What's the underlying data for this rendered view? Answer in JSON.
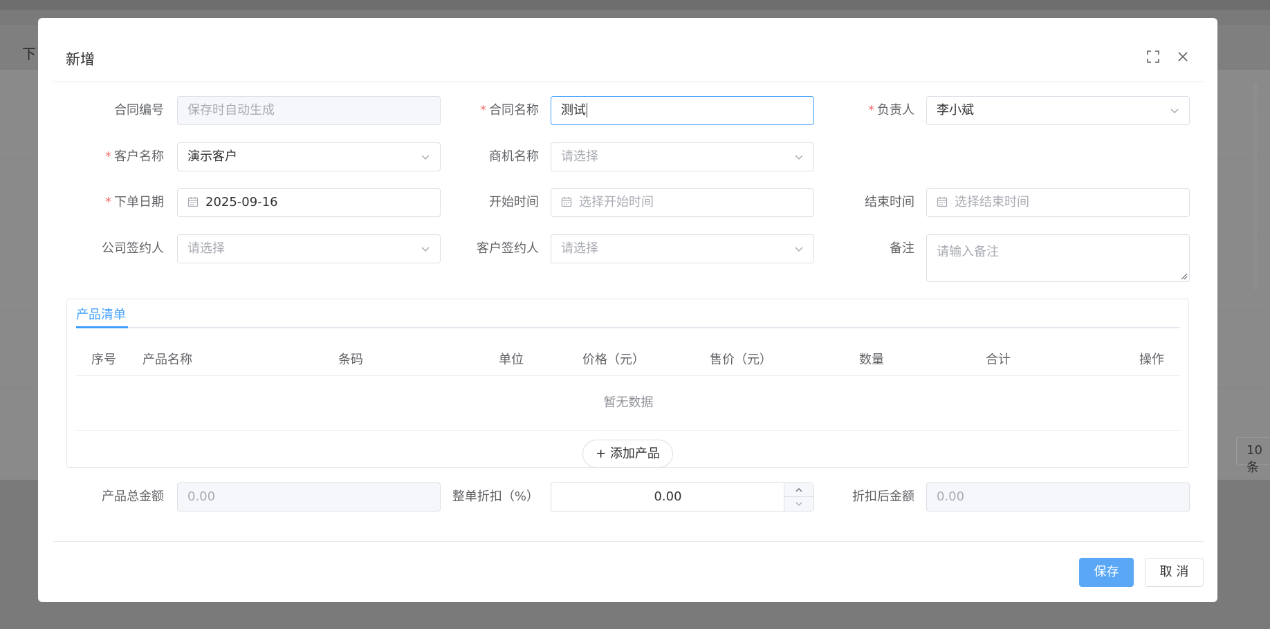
{
  "background": {
    "title": "下",
    "page_size": "10条"
  },
  "dialog": {
    "title": "新增",
    "fields": {
      "contract_no": {
        "label": "合同编号",
        "placeholder": "保存时自动生成"
      },
      "contract_name": {
        "label": "合同名称",
        "value": "测试"
      },
      "owner": {
        "label": "负责人",
        "value": "李小斌"
      },
      "customer": {
        "label": "客户名称",
        "value": "演示客户"
      },
      "opportunity": {
        "label": "商机名称",
        "placeholder": "请选择"
      },
      "order_date": {
        "label": "下单日期",
        "value": "2025-09-16"
      },
      "start_time": {
        "label": "开始时间",
        "placeholder": "选择开始时间"
      },
      "end_time": {
        "label": "结束时间",
        "placeholder": "选择结束时间"
      },
      "company_signer": {
        "label": "公司签约人",
        "placeholder": "请选择"
      },
      "customer_signer": {
        "label": "客户签约人",
        "placeholder": "请选择"
      },
      "remark": {
        "label": "备注",
        "placeholder": "请输入备注"
      }
    },
    "products": {
      "tab": "产品清单",
      "columns": [
        "序号",
        "产品名称",
        "条码",
        "单位",
        "价格（元）",
        "售价（元）",
        "数量",
        "合计",
        "操作"
      ],
      "empty_text": "暂无数据",
      "add_button": "+ 添加产品"
    },
    "totals": {
      "total_label": "产品总金额",
      "total_value": "0.00",
      "discount_label": "整单折扣（%）",
      "discount_value": "0.00",
      "after_label": "折扣后金额",
      "after_value": "0.00"
    },
    "buttons": {
      "save": "保存",
      "cancel": "取 消"
    }
  }
}
